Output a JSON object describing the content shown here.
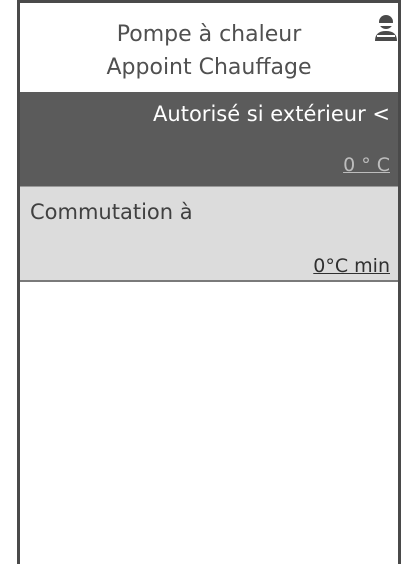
{
  "header": {
    "title_line1": "Pompe à chaleur",
    "title_line2": "Appoint Chauffage",
    "user_icon": "user-icon"
  },
  "settings": [
    {
      "label": "Autorisé si extérieur <",
      "value": "0 ° C",
      "selected": true
    },
    {
      "label": "Commutation à",
      "value": "0°C min",
      "selected": false
    }
  ],
  "colors": {
    "selected_row_bg": "#5b5b5b",
    "unselected_row_bg": "#dcdcdc",
    "frame_border": "#4a4a4a"
  }
}
